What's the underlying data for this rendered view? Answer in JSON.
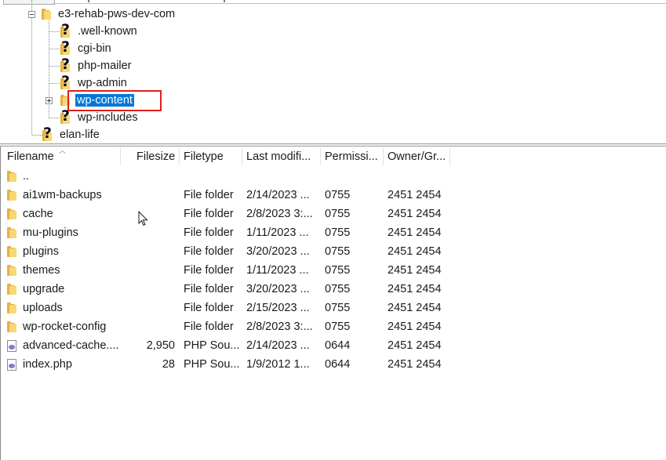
{
  "tree": {
    "root": "e3-rehab-pws-dev-com",
    "children": [
      {
        "label": ".well-known",
        "state": "unknown"
      },
      {
        "label": "cgi-bin",
        "state": "unknown"
      },
      {
        "label": "php-mailer",
        "state": "unknown"
      },
      {
        "label": "wp-admin",
        "state": "unknown"
      },
      {
        "label": "wp-content",
        "state": "selected"
      },
      {
        "label": "wp-includes",
        "state": "unknown"
      }
    ],
    "sibling": "elan-life"
  },
  "file_list": {
    "columns": [
      "Filename",
      "Filesize",
      "Filetype",
      "Last modifi...",
      "Permissi...",
      "Owner/Gr..."
    ],
    "rows": [
      {
        "name": "..",
        "size": "",
        "type": "",
        "modified": "",
        "perm": "",
        "owner": "",
        "icon": "folder"
      },
      {
        "name": "ai1wm-backups",
        "size": "",
        "type": "File folder",
        "modified": "2/14/2023 ...",
        "perm": "0755",
        "owner": "2451 2454",
        "icon": "folder"
      },
      {
        "name": "cache",
        "size": "",
        "type": "File folder",
        "modified": "2/8/2023 3:...",
        "perm": "0755",
        "owner": "2451 2454",
        "icon": "folder"
      },
      {
        "name": "mu-plugins",
        "size": "",
        "type": "File folder",
        "modified": "1/11/2023 ...",
        "perm": "0755",
        "owner": "2451 2454",
        "icon": "folder"
      },
      {
        "name": "plugins",
        "size": "",
        "type": "File folder",
        "modified": "3/20/2023 ...",
        "perm": "0755",
        "owner": "2451 2454",
        "icon": "folder"
      },
      {
        "name": "themes",
        "size": "",
        "type": "File folder",
        "modified": "1/11/2023 ...",
        "perm": "0755",
        "owner": "2451 2454",
        "icon": "folder"
      },
      {
        "name": "upgrade",
        "size": "",
        "type": "File folder",
        "modified": "3/20/2023 ...",
        "perm": "0755",
        "owner": "2451 2454",
        "icon": "folder"
      },
      {
        "name": "uploads",
        "size": "",
        "type": "File folder",
        "modified": "2/15/2023 ...",
        "perm": "0755",
        "owner": "2451 2454",
        "icon": "folder"
      },
      {
        "name": "wp-rocket-config",
        "size": "",
        "type": "File folder",
        "modified": "2/8/2023 3:...",
        "perm": "0755",
        "owner": "2451 2454",
        "icon": "folder"
      },
      {
        "name": "advanced-cache....",
        "size": "2,950",
        "type": "PHP Sou...",
        "modified": "2/14/2023 ...",
        "perm": "0644",
        "owner": "2451 2454",
        "icon": "php-file"
      },
      {
        "name": "index.php",
        "size": "28",
        "type": "PHP Sou...",
        "modified": "1/9/2012 1...",
        "perm": "0644",
        "owner": "2451 2454",
        "icon": "php-file"
      }
    ]
  },
  "colors": {
    "selection": "#0078d7",
    "highlight_box": "#e0201b",
    "folder": "#f8d776"
  }
}
